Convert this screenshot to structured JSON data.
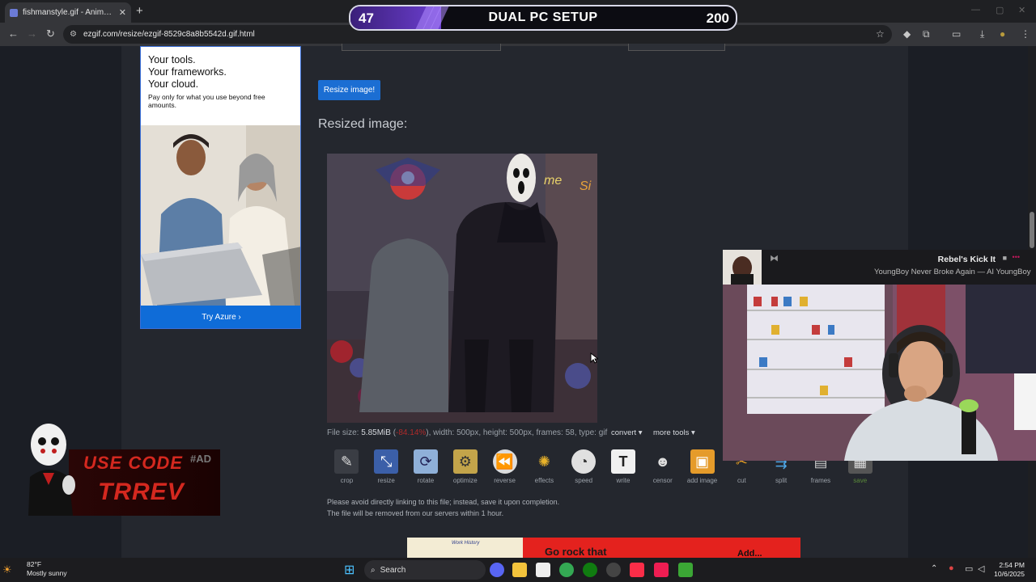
{
  "browser": {
    "tab_title": "fishmanstyle.gif - Animated im",
    "url": "ezgif.com/resize/ezgif-8529c8a8b5542d.gif.html"
  },
  "overlay": {
    "left_value": "47",
    "title": "DUAL PC SETUP",
    "right_value": "200"
  },
  "ad": {
    "headline_1": "Your tools.",
    "headline_2": "Your frameworks.",
    "headline_3": "Your cloud.",
    "body": "Pay only for what you use beyond free amounts.",
    "button": "Try Azure ›"
  },
  "main": {
    "resize_button": "Resize image!",
    "resized_heading": "Resized image:",
    "file_info": {
      "prefix": "File size: ",
      "size": "5.85MiB",
      "diff": "-84.14%",
      "rest": "), width: 500px, height: 500px, frames: 58, type: gif"
    },
    "convert_label": "convert",
    "more_tools_label": "more tools",
    "tools": [
      {
        "label": "crop",
        "icon": "crop-icon"
      },
      {
        "label": "resize",
        "icon": "resize-icon"
      },
      {
        "label": "rotate",
        "icon": "rotate-icon"
      },
      {
        "label": "optimize",
        "icon": "optimize-icon"
      },
      {
        "label": "reverse",
        "icon": "reverse-icon"
      },
      {
        "label": "effects",
        "icon": "effects-icon"
      },
      {
        "label": "speed",
        "icon": "speed-icon"
      },
      {
        "label": "write",
        "icon": "write-icon"
      },
      {
        "label": "censor",
        "icon": "censor-icon"
      },
      {
        "label": "add image",
        "icon": "add-image-icon"
      },
      {
        "label": "cut",
        "icon": "cut-icon"
      },
      {
        "label": "split",
        "icon": "split-icon"
      },
      {
        "label": "frames",
        "icon": "frames-icon"
      },
      {
        "label": "save",
        "icon": "save-icon"
      }
    ],
    "notice_1": "Please avoid directly linking to this file; instead, save it upon completion.",
    "notice_2": "The file will be removed from our servers within 1 hour."
  },
  "bottom_ad": {
    "tag": "Work History",
    "text": "Go rock that",
    "right_text": "Add..."
  },
  "music": {
    "title": "Rebel's Kick It",
    "artist": "YoungBoy Never Broke Again — AI YoungBoy"
  },
  "promo": {
    "code_text": "USE CODE",
    "code": "TRREV",
    "tag": "#AD"
  },
  "taskbar": {
    "temp": "82°F",
    "condition": "Mostly sunny",
    "search": "Search",
    "time": "2:54 PM",
    "date": "10/6/2025"
  }
}
